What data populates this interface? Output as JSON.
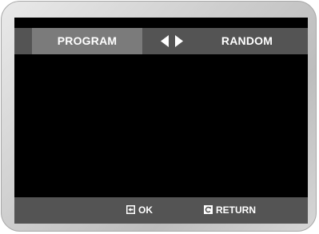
{
  "menu": {
    "tabs": [
      {
        "label": "PROGRAM",
        "selected": true
      },
      {
        "label": "RANDOM",
        "selected": false
      }
    ],
    "navigation_icon": "left-right-arrows-icon"
  },
  "footer": {
    "ok_label": "OK",
    "ok_icon": "enter-icon",
    "return_label": "RETURN",
    "return_icon": "return-icon"
  },
  "colors": {
    "bar": "#545454",
    "selected_tab": "#7b7b7b",
    "screen": "#000000",
    "text": "#ffffff"
  }
}
